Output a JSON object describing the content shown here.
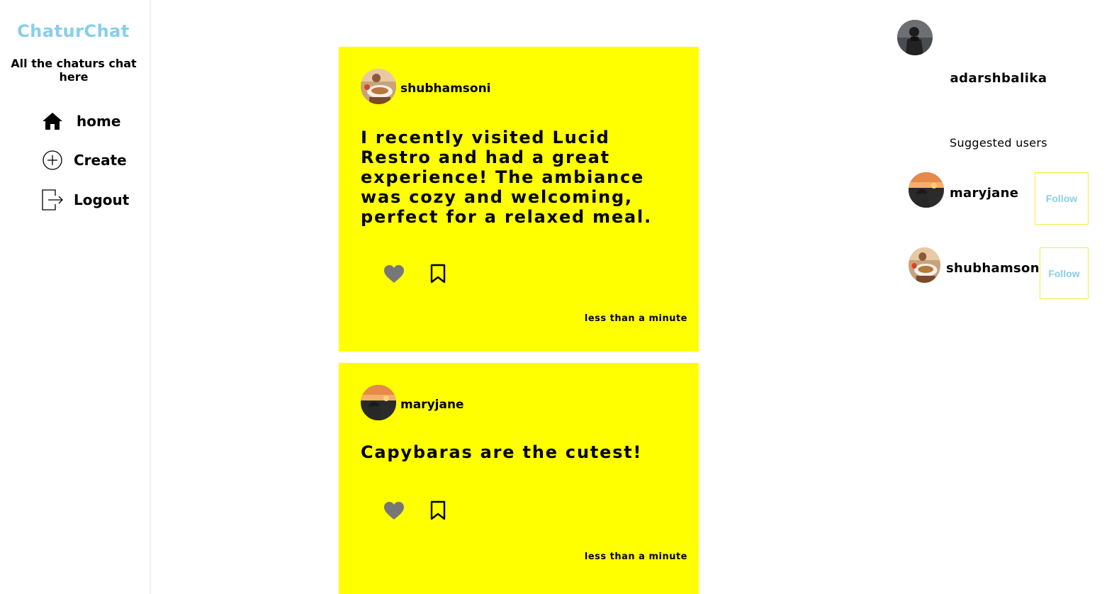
{
  "app": {
    "name": "ChaturChat",
    "tagline": "All the chaturs chat here"
  },
  "colors": {
    "brand": "#87ceeb",
    "post_background": "#ffff00",
    "follow_text": "#87ceeb",
    "follow_border": "#f5ef3a",
    "like_icon": "#777777"
  },
  "nav": [
    {
      "label": "home",
      "icon": "home-icon"
    },
    {
      "label": "Create",
      "icon": "plus-circle-icon"
    },
    {
      "label": "Logout",
      "icon": "logout-icon"
    }
  ],
  "posts": [
    {
      "username": "shubhamsoni",
      "avatar": "food-photo-avatar",
      "text": "I recently visited Lucid Restro and had a great experience! The ambiance was cozy and welcoming, perfect for a relaxed meal.",
      "time": "less than a minute"
    },
    {
      "username": "maryjane",
      "avatar": "sunset-photo-avatar",
      "text": "Capybaras are the cutest!",
      "time": "less than a minute"
    }
  ],
  "current_user": {
    "username": "adarshbalika",
    "avatar": "camera-person-avatar"
  },
  "suggested": {
    "title": "Suggested users",
    "users": [
      {
        "username": "maryjane",
        "avatar": "sunset-photo-avatar",
        "follow_label": "Follow"
      },
      {
        "username": "shubhamsoni",
        "avatar": "food-photo-avatar",
        "follow_label": "Follow"
      }
    ]
  }
}
